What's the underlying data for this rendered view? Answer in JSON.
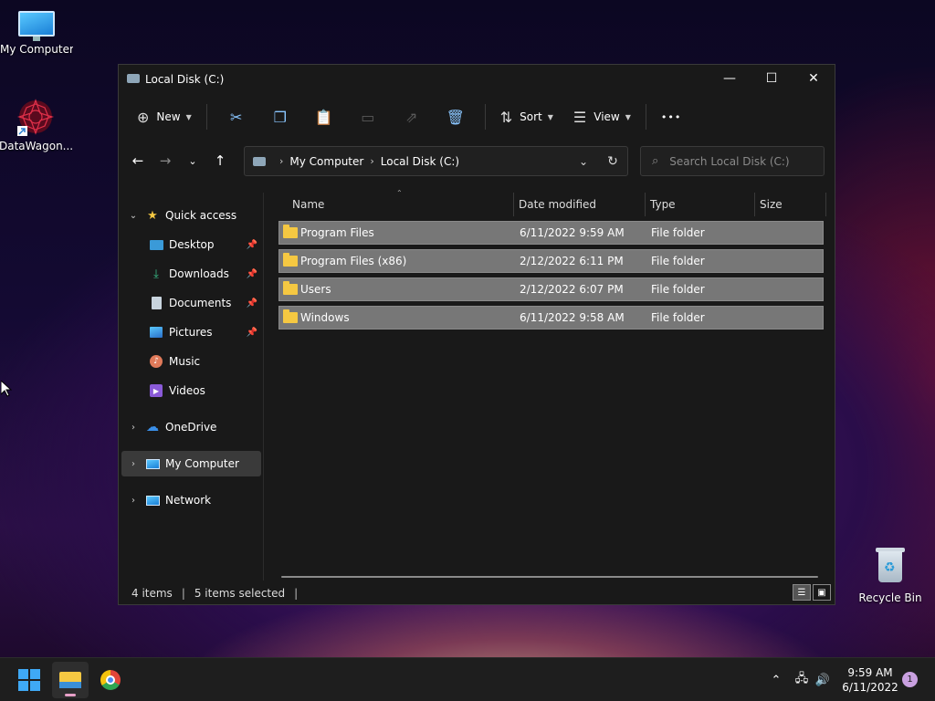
{
  "desktop": {
    "icons": [
      {
        "label": "My Computer"
      },
      {
        "label": "DataWagon..."
      },
      {
        "label": "Recycle Bin"
      }
    ]
  },
  "window": {
    "title": "Local Disk (C:)",
    "controls": {
      "minimize": "—",
      "maximize": "☐",
      "close": "✕"
    }
  },
  "toolbar": {
    "new_label": "New",
    "sort_label": "Sort",
    "view_label": "View",
    "more_label": "•••",
    "icons": [
      "cut-icon",
      "copy-icon",
      "paste-icon",
      "rename-icon",
      "share-icon",
      "delete-icon"
    ]
  },
  "address": {
    "crumbs": [
      "My Computer",
      "Local Disk (C:)"
    ],
    "search_placeholder": "Search Local Disk (C:)"
  },
  "nav_pane": {
    "quick_access": "Quick access",
    "quick_items": [
      {
        "label": "Desktop",
        "pinned": true
      },
      {
        "label": "Downloads",
        "pinned": true
      },
      {
        "label": "Documents",
        "pinned": true
      },
      {
        "label": "Pictures",
        "pinned": true
      },
      {
        "label": "Music",
        "pinned": false
      },
      {
        "label": "Videos",
        "pinned": false
      }
    ],
    "onedrive": "OneDrive",
    "my_computer": "My Computer",
    "network": "Network"
  },
  "columns": {
    "name": "Name",
    "date": "Date modified",
    "type": "Type",
    "size": "Size"
  },
  "files": [
    {
      "name": "Program Files",
      "date": "6/11/2022 9:59 AM",
      "type": "File folder"
    },
    {
      "name": "Program Files (x86)",
      "date": "2/12/2022 6:11 PM",
      "type": "File folder"
    },
    {
      "name": "Users",
      "date": "2/12/2022 6:07 PM",
      "type": "File folder"
    },
    {
      "name": "Windows",
      "date": "6/11/2022 9:58 AM",
      "type": "File folder"
    }
  ],
  "status": {
    "items": "4 items",
    "selected": "5 items selected"
  },
  "taskbar": {
    "time": "9:59 AM",
    "date": "6/11/2022",
    "notification_count": "1"
  }
}
